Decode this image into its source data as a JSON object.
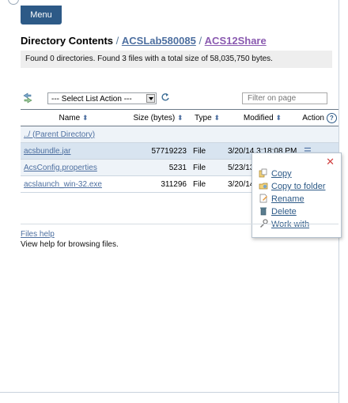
{
  "menu": {
    "label": "Menu"
  },
  "breadcrumb": {
    "title": "Directory Contents",
    "sep1": " / ",
    "crumb1": "ACSLab580085",
    "sep2": " / ",
    "crumb2": "ACS12Share"
  },
  "summary": "Found 0 directories. Found 3 files with a total size of 58,035,750 bytes.",
  "toolbar": {
    "select_action": "--- Select List Action ---",
    "filter_placeholder": "Filter on page"
  },
  "table": {
    "headers": {
      "name": "Name",
      "size": "Size (bytes)",
      "type": "Type",
      "modified": "Modified",
      "action": "Action"
    },
    "parent": "../ (Parent Directory)",
    "rows": [
      {
        "name": "acsbundle.jar",
        "size": "57719223",
        "type": "File",
        "modified": "3/20/14 3:18:08 PM"
      },
      {
        "name": "AcsConfig.properties",
        "size": "5231",
        "type": "File",
        "modified": "5/23/13 7:"
      },
      {
        "name": "acslaunch_win-32.exe",
        "size": "311296",
        "type": "File",
        "modified": "3/20/14 2:"
      }
    ]
  },
  "context_menu": {
    "items": [
      "Copy",
      "Copy to folder",
      "Rename",
      "Delete",
      "Work with"
    ]
  },
  "help": {
    "link": "Files help",
    "desc": "View help for browsing files."
  },
  "colors": {
    "accent": "#2d5a87",
    "link": "#4d6fa0",
    "visited": "#8a5ab0",
    "close": "#d04040"
  }
}
